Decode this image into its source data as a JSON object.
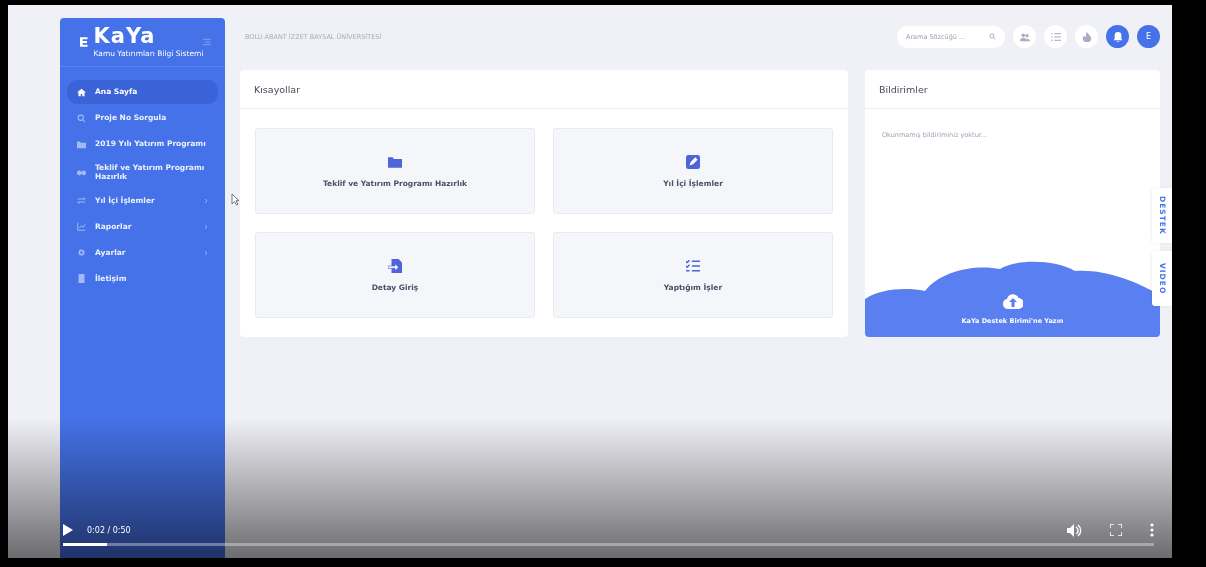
{
  "sidebar": {
    "logo": {
      "title": "KaYa",
      "subtitle": "Kamu Yatırımları Bilgi Sistemi"
    },
    "items": [
      {
        "kind": "home",
        "label": "Ana Sayfa",
        "selected": true,
        "expandable": false
      },
      {
        "kind": "search",
        "label": "Proje No Sorgula",
        "selected": false,
        "expandable": false
      },
      {
        "kind": "folder",
        "label": "2019 Yılı Yatırım Programı",
        "selected": false,
        "expandable": false
      },
      {
        "kind": "hands",
        "label": "Teklif ve Yatırım Programı Hazırlık",
        "selected": false,
        "expandable": false
      },
      {
        "kind": "swap",
        "label": "Yıl İçi İşlemler",
        "selected": false,
        "expandable": true
      },
      {
        "kind": "chart",
        "label": "Raporlar",
        "selected": false,
        "expandable": true
      },
      {
        "kind": "gear",
        "label": "Ayarlar",
        "selected": false,
        "expandable": true
      },
      {
        "kind": "contact",
        "label": "İletişim",
        "selected": false,
        "expandable": false
      }
    ]
  },
  "header": {
    "organization": "BOLU ABANT İZZET BAYSAL ÜNİVERSİTESİ",
    "search": {
      "placeholder": "Arama Sözcüğü ..."
    },
    "buttons": [
      {
        "kind": "users",
        "highlighted": false
      },
      {
        "kind": "list",
        "highlighted": false
      },
      {
        "kind": "fire",
        "highlighted": false
      },
      {
        "kind": "bell",
        "highlighted": true
      }
    ],
    "avatar": "E"
  },
  "shortcuts": {
    "title": "Kısayollar",
    "tiles": [
      {
        "kind": "folder",
        "label": "Teklif ve Yatırım Programı Hazırlık"
      },
      {
        "kind": "edit",
        "label": "Yıl İçi İşlemler"
      },
      {
        "kind": "file-in",
        "label": "Detay Giriş"
      },
      {
        "kind": "checklist",
        "label": "Yaptığım İşler"
      }
    ]
  },
  "notifications": {
    "title": "Bildirimler",
    "empty_text": "Okunmamış bildiriminiz yoktur...",
    "support_label": "KaYa Destek Birimi'ne Yazın"
  },
  "side_tabs": [
    "DESTEK",
    "VIDEO"
  ],
  "player": {
    "time": "0:02 / 0:50",
    "level": 0.04
  }
}
